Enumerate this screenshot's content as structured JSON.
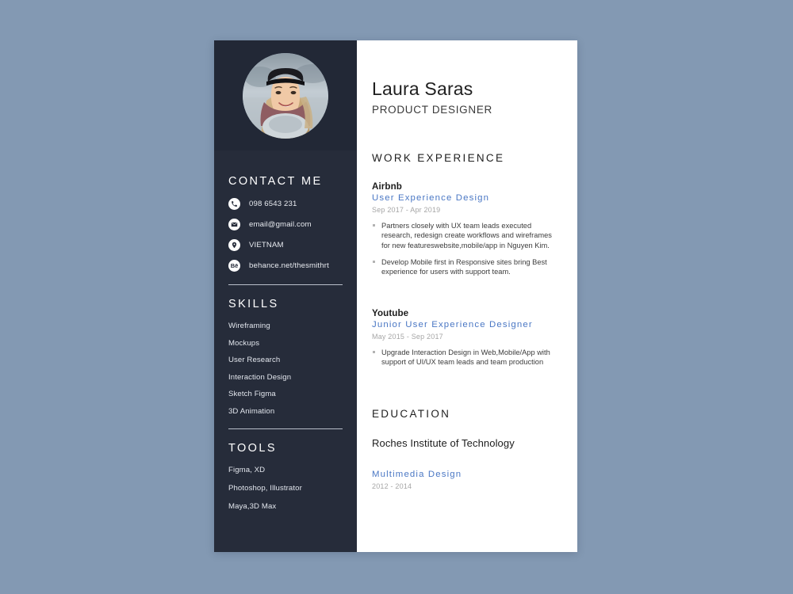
{
  "page": {
    "background_color": "#8399b3",
    "card_background": "#ffffff",
    "sidebar_color": "#262c3a",
    "accent_color": "#4a77c4"
  },
  "sidebar": {
    "avatar": {
      "icon": "profile-photo",
      "alt": "smiling woman wearing black beanie and gray scarf"
    },
    "contact": {
      "heading": "CONTACT ME",
      "items": [
        {
          "icon": "phone-icon",
          "text": "098 6543 231"
        },
        {
          "icon": "envelope-icon",
          "text": "email@gmail.com"
        },
        {
          "icon": "location-pin-icon",
          "text": "VIETNAM"
        },
        {
          "icon": "behance-icon",
          "text": "behance.net/thesmithrt"
        }
      ]
    },
    "skills": {
      "heading": "SKILLS",
      "items": [
        "Wireframing",
        "Mockups",
        "User Research",
        "Interaction Design",
        "Sketch Figma",
        "3D Animation"
      ]
    },
    "tools": {
      "heading": "TOOLS",
      "items": [
        "Figma, XD",
        "Photoshop, Illustrator",
        "Maya,3D Max"
      ]
    }
  },
  "main": {
    "name": "Laura Saras",
    "role": "PRODUCT DESIGNER",
    "work": {
      "heading": "WORK EXPERIENCE",
      "entries": [
        {
          "org": "Airbnb",
          "title": "User Experience Design",
          "dates": "Sep 2017 - Apr 2019",
          "bullets": [
            "Partners closely with UX team leads executed research, redesign create workflows and wireframes for new featureswebsite,mobile/app in Nguyen Kim.",
            "Develop Mobile first in Responsive sites bring Best experience for users with support team."
          ]
        },
        {
          "org": "Youtube",
          "title": "Junior User Experience Designer",
          "dates": "May 2015 - Sep 2017",
          "bullets": [
            "Upgrade Interaction Design in Web,Mobile/App with support of UI/UX team leads and team production"
          ]
        }
      ]
    },
    "education": {
      "heading": "EDUCATION",
      "school": "Roches Institute of Technology",
      "program": "Multimedia Design",
      "dates": "2012 - 2014"
    }
  }
}
